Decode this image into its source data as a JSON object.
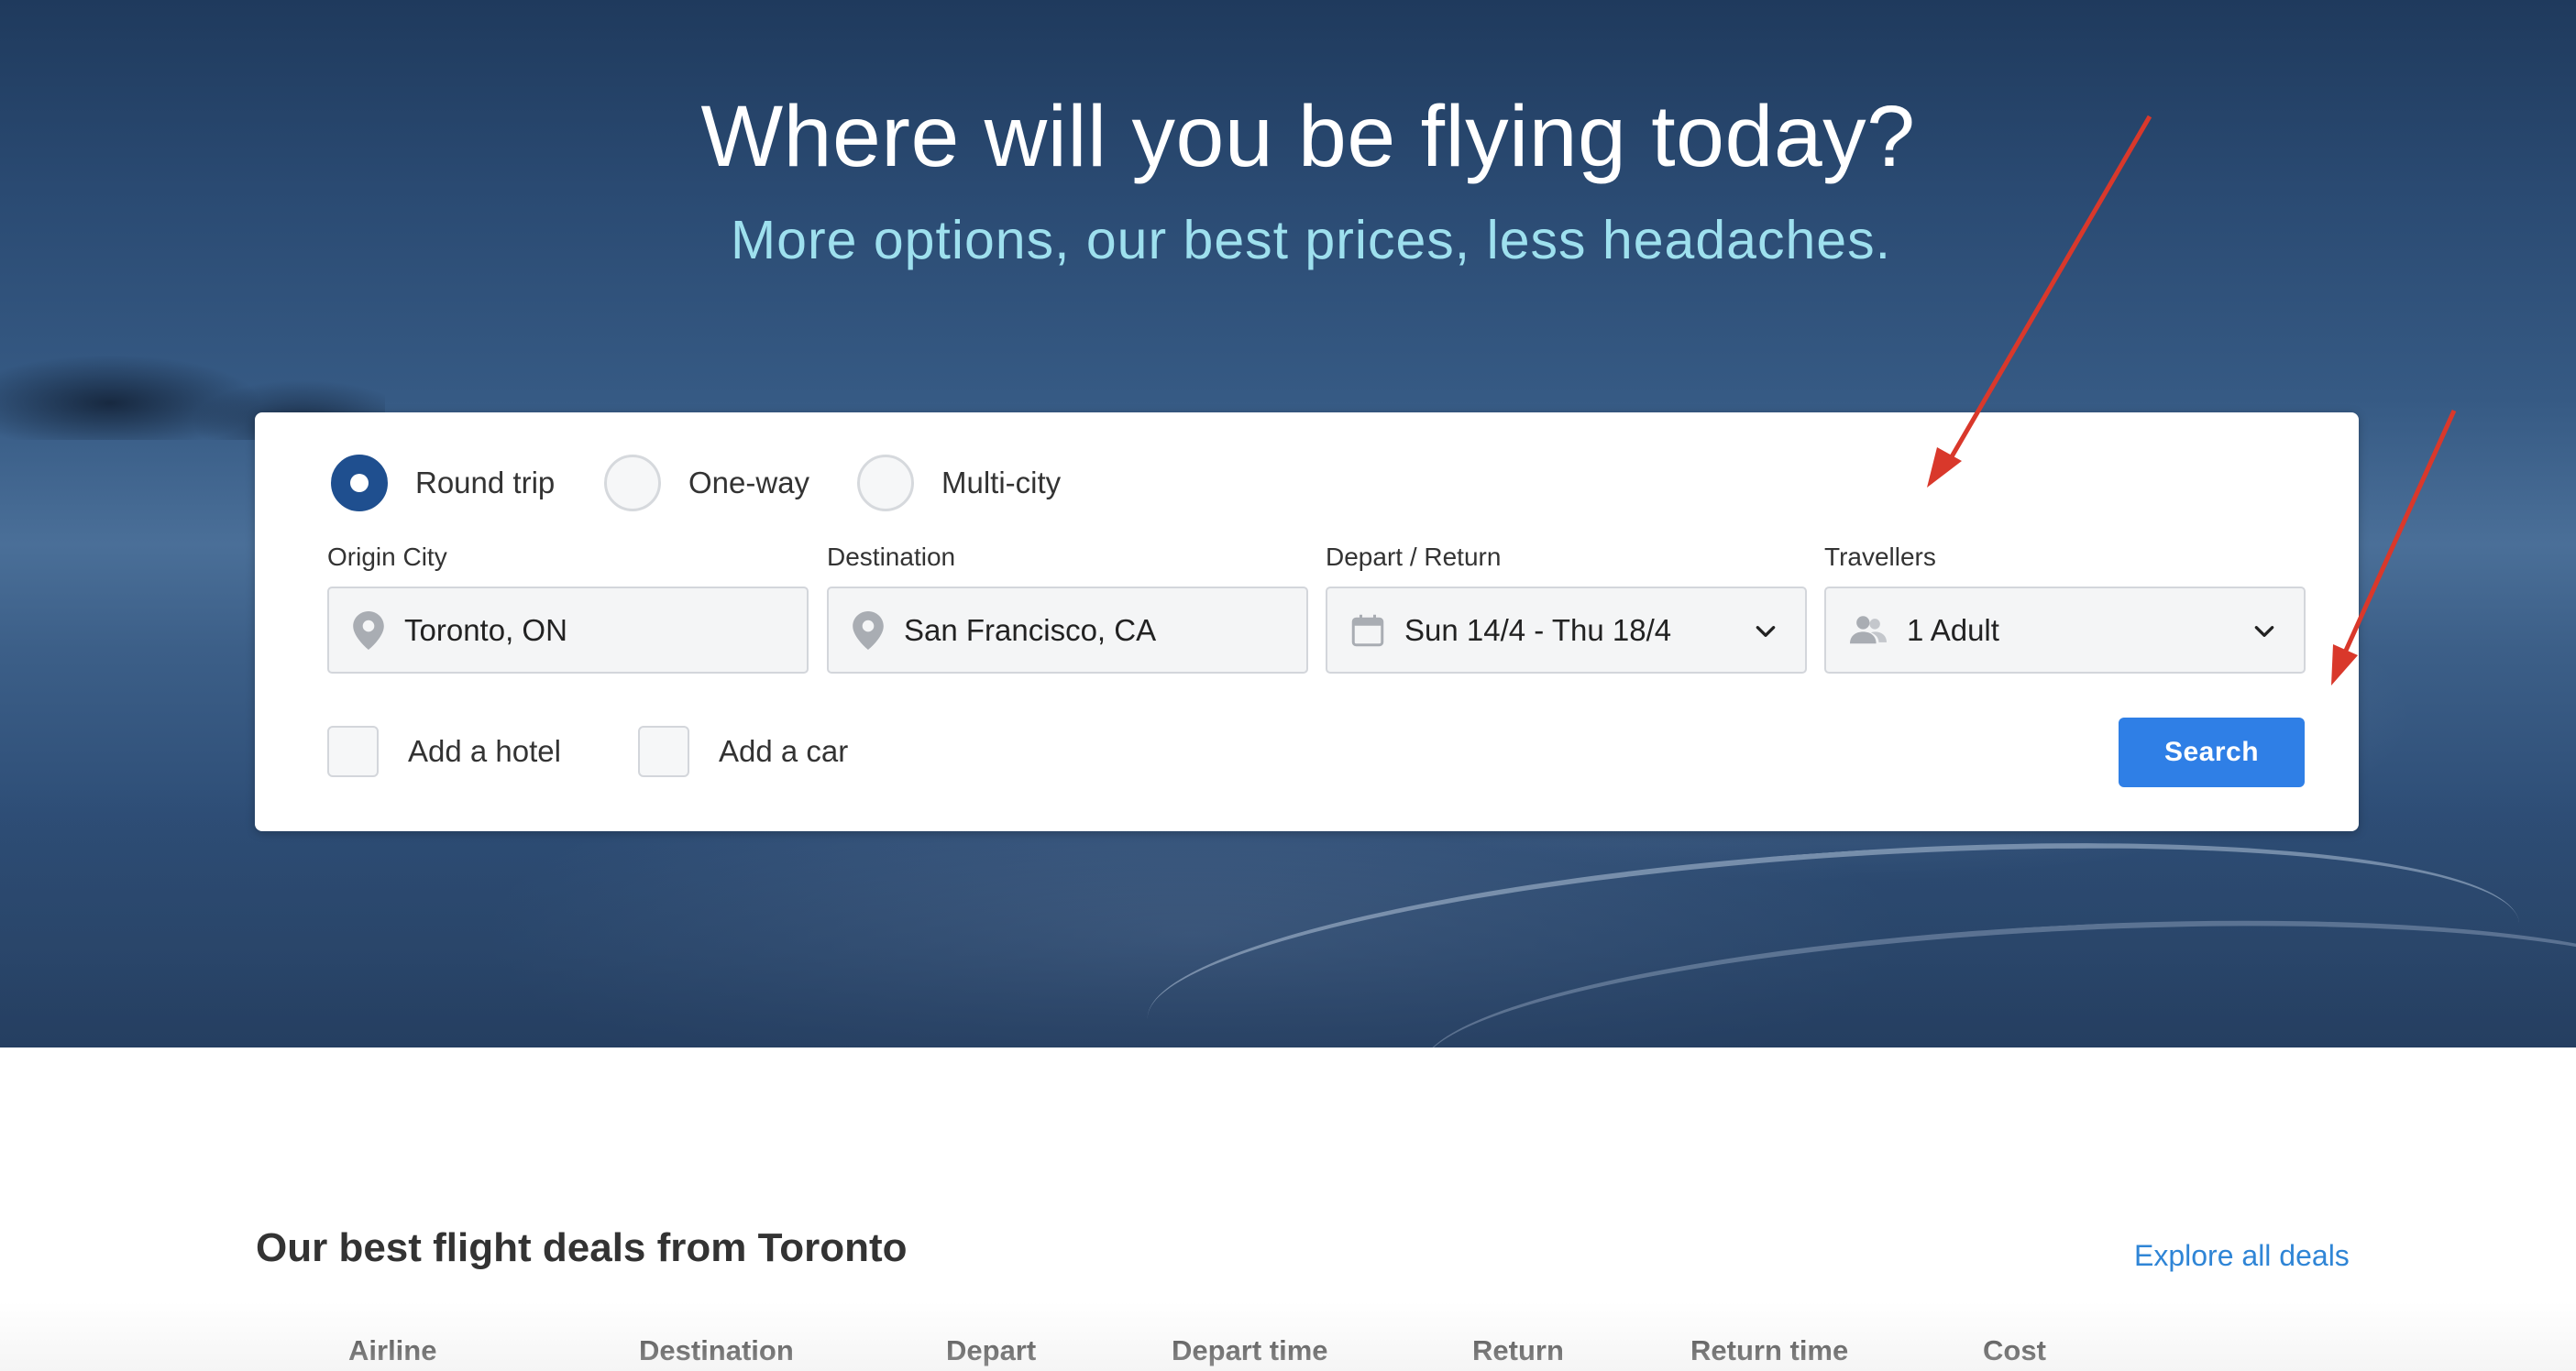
{
  "hero": {
    "title": "Where will you be flying today?",
    "subtitle": "More options, our best prices, less headaches."
  },
  "search": {
    "trip_types": [
      {
        "label": "Round trip",
        "selected": true
      },
      {
        "label": "One-way",
        "selected": false
      },
      {
        "label": "Multi-city",
        "selected": false
      }
    ],
    "fields": {
      "origin": {
        "label": "Origin City",
        "value": "Toronto, ON",
        "icon": "location-pin-icon"
      },
      "destination": {
        "label": "Destination",
        "value": "San Francisco, CA",
        "icon": "location-pin-icon"
      },
      "dates": {
        "label": "Depart / Return",
        "value": "Sun 14/4 - Thu 18/4",
        "icon": "calendar-icon"
      },
      "travellers": {
        "label": "Travellers",
        "value": "1 Adult",
        "icon": "people-icon"
      }
    },
    "addons": [
      {
        "label": "Add a hotel",
        "checked": false
      },
      {
        "label": "Add a car",
        "checked": false
      }
    ],
    "search_label": "Search"
  },
  "deals": {
    "title": "Our best flight deals from Toronto",
    "explore_label": "Explore all deals",
    "columns": [
      "Airline",
      "Destination",
      "Depart",
      "Depart time",
      "Return",
      "Return time",
      "Cost"
    ]
  },
  "colors": {
    "primary_button": "#2f7fe6",
    "radio_selected": "#1f4f8f",
    "subtitle": "#9ee0ee",
    "link": "#2f85d6",
    "annotation_arrow": "#d9382b"
  }
}
